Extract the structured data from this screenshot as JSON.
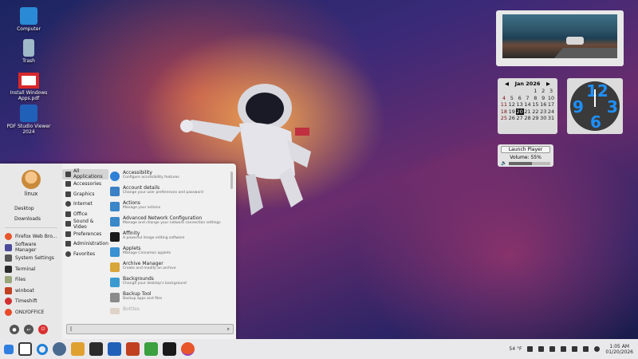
{
  "desktop": {
    "icons": [
      {
        "label": "Computer",
        "icon": "computer-icon",
        "color": "#2a8ad6"
      },
      {
        "label": "Trash",
        "icon": "trash-icon",
        "color": "#9fb9c9"
      },
      {
        "label": "Install Windows Apps.pdf",
        "icon": "pdf-file-icon",
        "color": "#d8282a"
      },
      {
        "label": "PDF Studio Viewer 2024",
        "icon": "pdf-studio-icon",
        "color": "#2060b8"
      }
    ]
  },
  "widgets": {
    "calendar": {
      "month": "Jan 2026",
      "weekday_headers": [
        "",
        "",
        "",
        "",
        "",
        "",
        ""
      ],
      "days": [
        [
          "",
          "",
          "",
          "",
          "1",
          "2",
          "3"
        ],
        [
          "4",
          "5",
          "6",
          "7",
          "8",
          "9",
          "10"
        ],
        [
          "11",
          "12",
          "13",
          "14",
          "15",
          "16",
          "17"
        ],
        [
          "18",
          "19",
          "20",
          "21",
          "22",
          "23",
          "24"
        ],
        [
          "25",
          "26",
          "27",
          "28",
          "29",
          "30",
          "31"
        ]
      ],
      "today": "20"
    },
    "clock": {
      "hour_left": "9",
      "hour_right": "3",
      "top": "12",
      "bottom": "6",
      "color": "#1e90ff"
    },
    "player": {
      "launch_label": "Launch Player",
      "volume_label": "Volume: 55%",
      "volume": 0.55
    }
  },
  "menu": {
    "username": "linux",
    "places": [
      "Desktop",
      "Downloads"
    ],
    "favorites": [
      {
        "label": "Firefox Web Bro...",
        "icon": "firefox-icon",
        "color": "#e8552a"
      },
      {
        "label": "Software Manager",
        "icon": "software-manager-icon",
        "color": "#4a4a9a"
      },
      {
        "label": "System Settings",
        "icon": "settings-icon",
        "color": "#555555"
      },
      {
        "label": "Terminal",
        "icon": "terminal-icon",
        "color": "#2b2b2b"
      },
      {
        "label": "Files",
        "icon": "folder-icon",
        "color": "#9aa57a"
      },
      {
        "label": "winboat",
        "icon": "winboat-icon",
        "color": "#c04020"
      },
      {
        "label": "Timeshift",
        "icon": "timeshift-icon",
        "color": "#d23030"
      },
      {
        "label": "ONLYOFFICE",
        "icon": "onlyoffice-icon",
        "color": "#e84a2a"
      }
    ],
    "categories": [
      {
        "label": "All Applications",
        "icon": "grid-icon"
      },
      {
        "label": "Accessories",
        "icon": "accessories-icon"
      },
      {
        "label": "Graphics",
        "icon": "graphics-icon"
      },
      {
        "label": "Internet",
        "icon": "internet-icon"
      },
      {
        "label": "Office",
        "icon": "office-icon"
      },
      {
        "label": "Sound & Video",
        "icon": "sound-video-icon"
      },
      {
        "label": "Preferences",
        "icon": "preferences-icon"
      },
      {
        "label": "Administration",
        "icon": "administration-icon"
      },
      {
        "label": "Favorites",
        "icon": "favorites-icon"
      }
    ],
    "apps": [
      {
        "name": "Accessibility",
        "desc": "Configure accessibility features",
        "icon": "accessibility-icon",
        "color": "#2f7fd6"
      },
      {
        "name": "Account details",
        "desc": "Change your user preferences and password",
        "icon": "account-icon",
        "color": "#3b7fc4"
      },
      {
        "name": "Actions",
        "desc": "Manage your actions",
        "icon": "actions-icon",
        "color": "#3a86c8"
      },
      {
        "name": "Advanced Network Configuration",
        "desc": "Manage and change your network connection settings",
        "icon": "network-icon",
        "color": "#3b88c8"
      },
      {
        "name": "Affinity",
        "desc": "A powerful image editing software",
        "icon": "affinity-icon",
        "color": "#1a1a1a"
      },
      {
        "name": "Applets",
        "desc": "Manage Cinnamon applets",
        "icon": "applets-icon",
        "color": "#3a90d0"
      },
      {
        "name": "Archive Manager",
        "desc": "Create and modify an archive",
        "icon": "archive-icon",
        "color": "#d8a53a"
      },
      {
        "name": "Backgrounds",
        "desc": "Change your desktop's background",
        "icon": "backgrounds-icon",
        "color": "#3a9ad0"
      },
      {
        "name": "Backup Tool",
        "desc": "Backup apps and files",
        "icon": "backup-icon",
        "color": "#8a8a8a"
      }
    ],
    "faded_next": "Bottles",
    "search": {
      "value": "|",
      "icon": "search-icon"
    }
  },
  "taskbar": {
    "launchers": [
      {
        "icon": "start-icon",
        "color": "#2f7fe0"
      },
      {
        "icon": "show-desktop-icon",
        "color": "#3a3a3a"
      },
      {
        "icon": "search-icon",
        "color": "#1e7fd8"
      },
      {
        "icon": "settings-icon",
        "color": "#4a6a90"
      },
      {
        "icon": "files-icon",
        "color": "#e0a030"
      },
      {
        "icon": "terminal-icon",
        "color": "#2b2b2b"
      },
      {
        "icon": "pdf-studio-icon",
        "color": "#2060b8"
      },
      {
        "icon": "winboat-icon",
        "color": "#c04020"
      },
      {
        "icon": "layers-icon",
        "color": "#3aa040"
      },
      {
        "icon": "affinity-icon",
        "color": "#1a1a1a"
      },
      {
        "icon": "firefox-icon",
        "color": "#e8552a"
      }
    ],
    "weather": "54 °F",
    "time": "1:05 AM",
    "date": "01/20/2026"
  }
}
